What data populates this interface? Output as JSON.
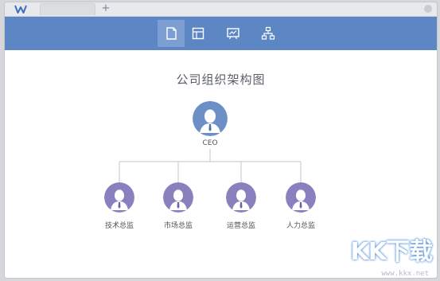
{
  "tabbar": {
    "new_tab_label": "+"
  },
  "toolbar": {
    "tools": [
      {
        "icon": "note-icon",
        "active": true
      },
      {
        "icon": "table-icon",
        "active": false
      },
      {
        "icon": "chart-board-icon",
        "active": false
      },
      {
        "icon": "org-chart-icon",
        "active": false
      }
    ],
    "colors": {
      "bar": "#5d86c5",
      "active": "#7c9ed3"
    }
  },
  "diagram": {
    "title": "公司组织架构图",
    "root": {
      "label": "CEO",
      "color": "#6d8fc8"
    },
    "children": [
      {
        "label": "技术总监",
        "color": "#8a80bd"
      },
      {
        "label": "市场总监",
        "color": "#8a80bd"
      },
      {
        "label": "运营总监",
        "color": "#8a80bd"
      },
      {
        "label": "人力总监",
        "color": "#8a80bd"
      }
    ]
  },
  "watermark": {
    "logo": "KK下载",
    "url": "www.kkx.net"
  }
}
